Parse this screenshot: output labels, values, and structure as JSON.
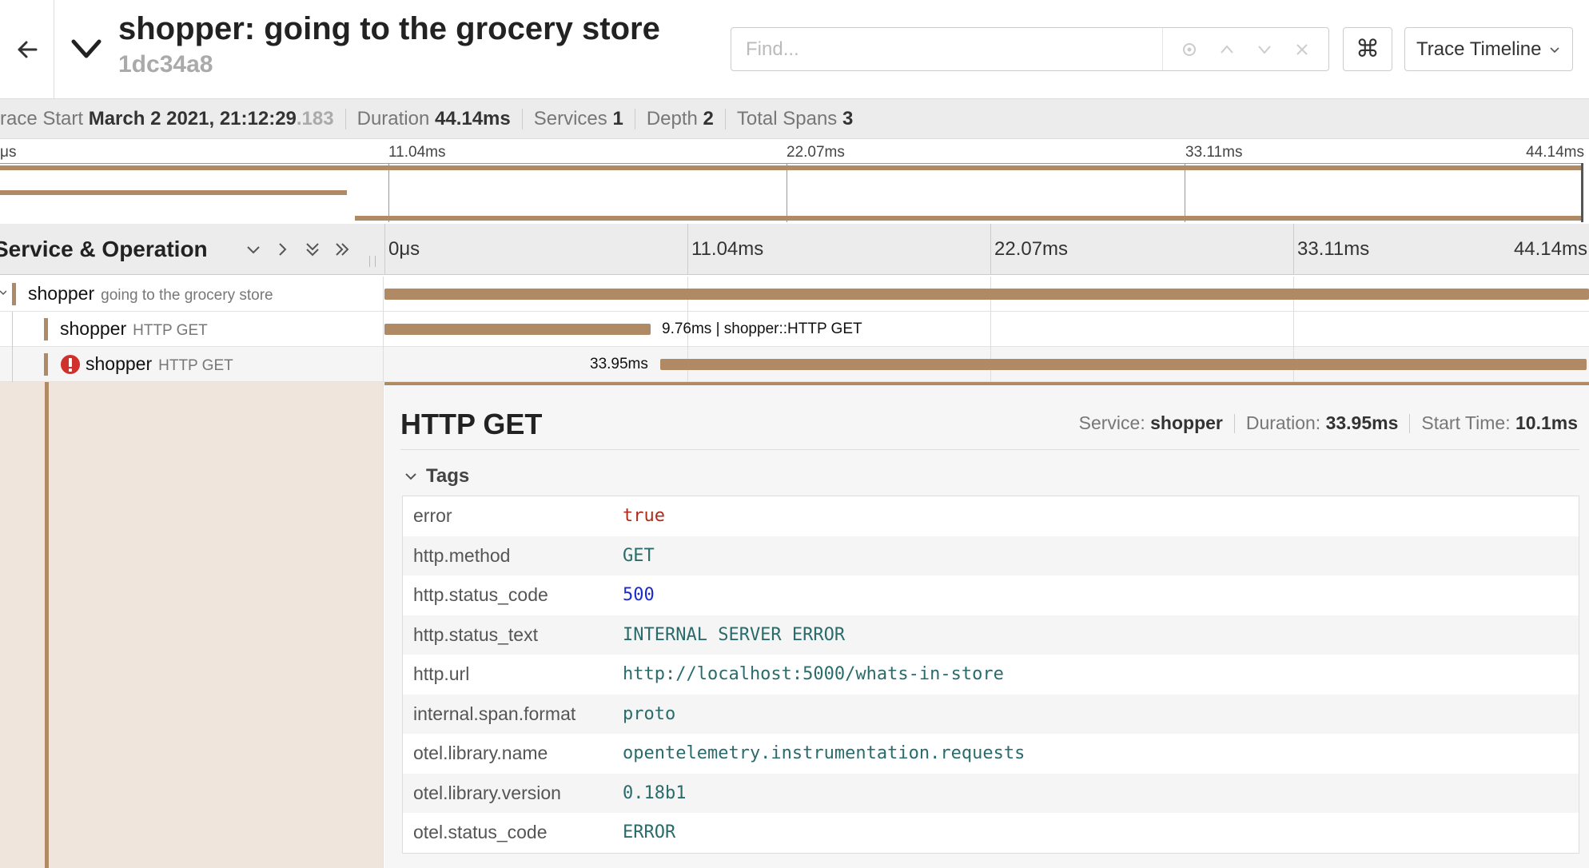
{
  "header": {
    "title": "shopper: going to the grocery store",
    "trace_id": "1dc34a8",
    "find_placeholder": "Find...",
    "view_select": "Trace Timeline"
  },
  "summary": {
    "trace_start_label": "race Start",
    "trace_start_value": "March 2 2021, 21:12:29",
    "trace_start_ms": ".183",
    "duration_label": "Duration",
    "duration_value": "44.14ms",
    "services_label": "Services",
    "services_value": "1",
    "depth_label": "Depth",
    "depth_value": "2",
    "total_spans_label": "Total Spans",
    "total_spans_value": "3"
  },
  "minimap": {
    "ticks": [
      "μs",
      "11.04ms",
      "22.07ms",
      "33.11ms",
      "44.14ms"
    ]
  },
  "timeline_header": {
    "title": "Service & Operation",
    "ticks": [
      "0μs",
      "11.04ms",
      "22.07ms",
      "33.11ms",
      "44.14ms"
    ]
  },
  "spans": [
    {
      "service": "shopper",
      "operation": "going to the grocery store",
      "start_ms": 0,
      "duration_ms": 44.14,
      "label": ""
    },
    {
      "service": "shopper",
      "operation": "HTTP GET",
      "start_ms": 0,
      "duration_ms": 9.76,
      "label": "9.76ms | shopper::HTTP GET"
    },
    {
      "service": "shopper",
      "operation": "HTTP GET",
      "start_ms": 10.1,
      "duration_ms": 33.95,
      "label": "33.95ms",
      "error": true
    }
  ],
  "detail": {
    "title": "HTTP GET",
    "service_label": "Service:",
    "service_value": "shopper",
    "duration_label": "Duration:",
    "duration_value": "33.95ms",
    "start_label": "Start Time:",
    "start_value": "10.1ms",
    "tags_label": "Tags",
    "tags": [
      {
        "key": "error",
        "value": "true",
        "type": "bool"
      },
      {
        "key": "http.method",
        "value": "GET",
        "type": "str"
      },
      {
        "key": "http.status_code",
        "value": "500",
        "type": "num"
      },
      {
        "key": "http.status_text",
        "value": "INTERNAL SERVER ERROR",
        "type": "str"
      },
      {
        "key": "http.url",
        "value": "http://localhost:5000/whats-in-store",
        "type": "str"
      },
      {
        "key": "internal.span.format",
        "value": "proto",
        "type": "str"
      },
      {
        "key": "otel.library.name",
        "value": "opentelemetry.instrumentation.requests",
        "type": "str"
      },
      {
        "key": "otel.library.version",
        "value": "0.18b1",
        "type": "str"
      },
      {
        "key": "otel.status_code",
        "value": "ERROR",
        "type": "str"
      }
    ]
  },
  "colors": {
    "span": "#b08a64",
    "error": "#d0312d",
    "detail_bg": "#f0e5dd"
  }
}
